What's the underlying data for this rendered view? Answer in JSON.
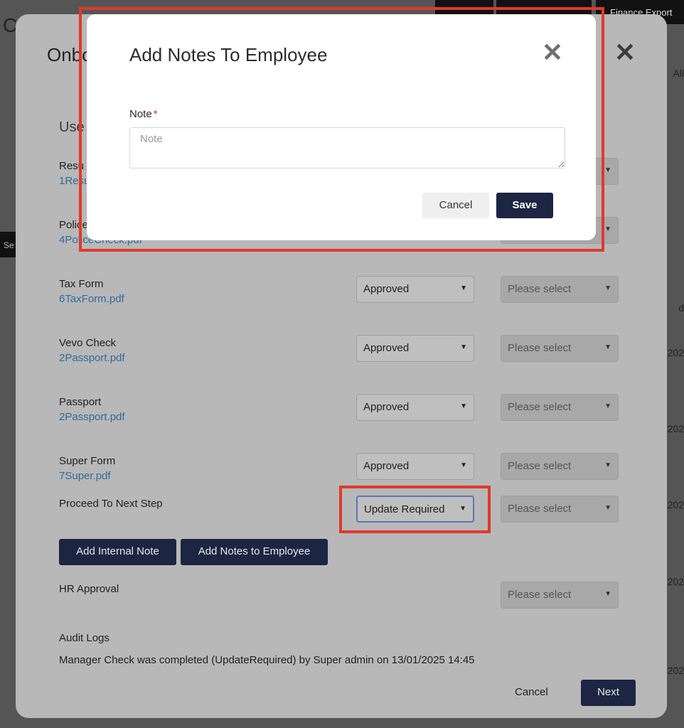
{
  "background": {
    "title_fragment": "C",
    "top_button_label": "Finance Export",
    "sidebar_fragment": "Se",
    "right_fragments": [
      "All",
      "d",
      "202",
      "202",
      "202",
      "202",
      "202",
      "202"
    ]
  },
  "onboarding": {
    "title": "Onbo",
    "section_title": "Use",
    "documents": [
      {
        "label": "Resu",
        "file": "1Resu",
        "status": "",
        "assign": ""
      },
      {
        "label": "Police",
        "file": "4PoliceCheck.pdf",
        "status": "",
        "assign": ""
      },
      {
        "label": "Tax Form",
        "file": "6TaxForm.pdf",
        "status": "Approved",
        "assign": "Please select"
      },
      {
        "label": "Vevo Check",
        "file": "2Passport.pdf",
        "status": "Approved",
        "assign": "Please select"
      },
      {
        "label": "Passport",
        "file": "2Passport.pdf",
        "status": "Approved",
        "assign": "Please select"
      },
      {
        "label": "Super Form",
        "file": "7Super.pdf",
        "status": "Approved",
        "assign": "Please select"
      }
    ],
    "proceed": {
      "label": "Proceed To Next Step",
      "status": "Update Required",
      "assign": "Please select"
    },
    "buttons": {
      "internal_note": "Add Internal Note",
      "notes_employee": "Add Notes to Employee"
    },
    "hr_approval": {
      "label": "HR Approval",
      "assign": "Please select"
    },
    "audit": {
      "title": "Audit Logs",
      "entry": "Manager Check was completed (UpdateRequired) by Super admin on 13/01/2025 14:45"
    },
    "footer": {
      "cancel": "Cancel",
      "next": "Next"
    }
  },
  "notes_dialog": {
    "title": "Add Notes To Employee",
    "note_label": "Note",
    "required_mark": "*",
    "note_placeholder": "Note",
    "note_value": "",
    "cancel": "Cancel",
    "save": "Save"
  },
  "colors": {
    "highlight": "#e0392b",
    "primary_button": "#1c2542",
    "link": "#2f6b9b"
  },
  "icons": {
    "close": "close-icon",
    "dropdown": "caret-down-icon"
  }
}
